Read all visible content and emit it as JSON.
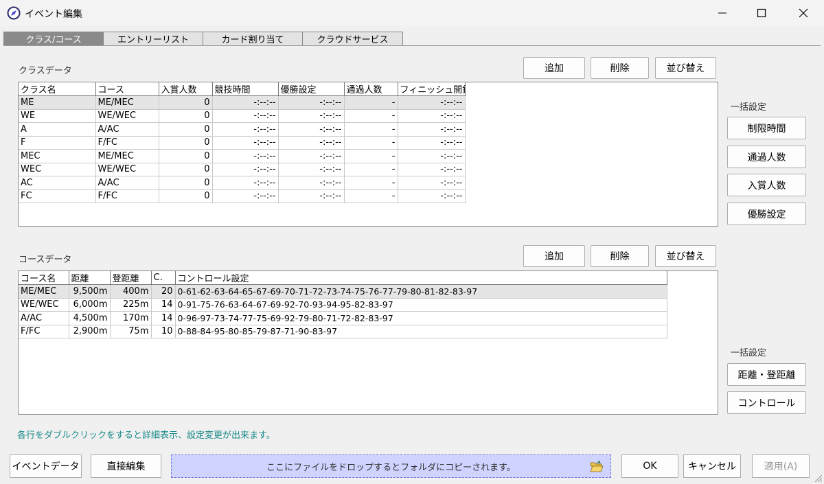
{
  "window": {
    "title": "イベント編集",
    "icon": "compass-icon",
    "minimize_icon": "minimize-icon",
    "maximize_icon": "maximize-icon",
    "close_icon": "close-icon"
  },
  "tabs": [
    {
      "label": "クラス/コース",
      "active": true
    },
    {
      "label": "エントリーリスト",
      "active": false
    },
    {
      "label": "カード割り当て",
      "active": false
    },
    {
      "label": "クラウドサービス",
      "active": false
    }
  ],
  "class_section": {
    "label": "クラスデータ",
    "buttons": {
      "add": "追加",
      "delete": "削除",
      "sort": "並び替え"
    },
    "columns": [
      "クラス名",
      "コース",
      "入賞人数",
      "競技時間",
      "優勝設定",
      "通過人数",
      "フィニッシュ開鎖"
    ],
    "rows": [
      [
        "ME",
        "ME/MEC",
        "0",
        "-:--:--",
        "-:--:--",
        "-",
        "-:--:--"
      ],
      [
        "WE",
        "WE/WEC",
        "0",
        "-:--:--",
        "-:--:--",
        "-",
        "-:--:--"
      ],
      [
        "A",
        "A/AC",
        "0",
        "-:--:--",
        "-:--:--",
        "-",
        "-:--:--"
      ],
      [
        "F",
        "F/FC",
        "0",
        "-:--:--",
        "-:--:--",
        "-",
        "-:--:--"
      ],
      [
        "MEC",
        "ME/MEC",
        "0",
        "-:--:--",
        "-:--:--",
        "-",
        "-:--:--"
      ],
      [
        "WEC",
        "WE/WEC",
        "0",
        "-:--:--",
        "-:--:--",
        "-",
        "-:--:--"
      ],
      [
        "AC",
        "A/AC",
        "0",
        "-:--:--",
        "-:--:--",
        "-",
        "-:--:--"
      ],
      [
        "FC",
        "F/FC",
        "0",
        "-:--:--",
        "-:--:--",
        "-",
        "-:--:--"
      ]
    ]
  },
  "bulk_class": {
    "label": "一括設定",
    "buttons": [
      "制限時間",
      "通過人数",
      "入賞人数",
      "優勝設定"
    ]
  },
  "course_section": {
    "label": "コースデータ",
    "buttons": {
      "add": "追加",
      "delete": "削除",
      "sort": "並び替え"
    },
    "columns": [
      "コース名",
      "距離",
      "登距離",
      "C.",
      "コントロール設定"
    ],
    "rows": [
      [
        "ME/MEC",
        "9,500m",
        "400m",
        "20",
        "0-61-62-63-64-65-67-69-70-71-72-73-74-75-76-77-79-80-81-82-83-97"
      ],
      [
        "WE/WEC",
        "6,000m",
        "225m",
        "14",
        "0-91-75-76-63-64-67-69-92-70-93-94-95-82-83-97"
      ],
      [
        "A/AC",
        "4,500m",
        "170m",
        "14",
        "0-96-97-73-74-77-75-69-92-79-80-71-72-82-83-97"
      ],
      [
        "F/FC",
        "2,900m",
        "75m",
        "10",
        "0-88-84-95-80-85-79-87-71-90-83-97"
      ]
    ]
  },
  "bulk_course": {
    "label": "一括設定",
    "buttons": [
      "距離・登距離",
      "コントロール"
    ]
  },
  "hint": "各行をダブルクリックをすると詳細表示、設定変更が出来ます。",
  "footer": {
    "event_data": "イベントデータ",
    "direct_edit": "直接編集",
    "dropzone": "ここにファイルをドロップするとフォルダにコピーされます。",
    "folder_icon": "folder-open-icon",
    "ok": "OK",
    "cancel": "キャンセル",
    "apply": "適用(A)"
  },
  "colors": {
    "tab_active": "#8a8a8a",
    "dropzone_bg": "#cfd3ff",
    "hint_text": "#1a8a8a",
    "selected_row": "#e5e5e5"
  }
}
